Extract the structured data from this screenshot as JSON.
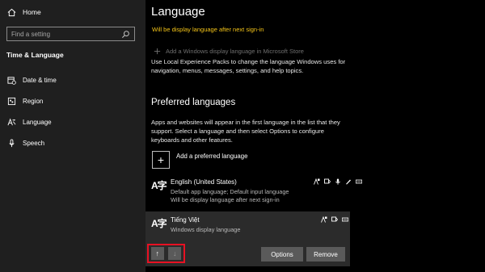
{
  "sidebar": {
    "home_label": "Home",
    "search_placeholder": "Find a setting",
    "section_title": "Time & Language",
    "items": [
      {
        "label": "Date & time",
        "icon": "calendar-clock-icon"
      },
      {
        "label": "Region",
        "icon": "globe-region-icon"
      },
      {
        "label": "Language",
        "icon": "language-icon"
      },
      {
        "label": "Speech",
        "icon": "microphone-icon"
      }
    ]
  },
  "main": {
    "title": "Language",
    "notice": "Will be display language after next sign-in",
    "store_link": "Add a Windows display language in Microsoft Store",
    "description": "Use Local Experience Packs to change the language Windows uses for navigation, menus, messages, settings, and help topics.",
    "preferred_heading": "Preferred languages",
    "preferred_description": "Apps and websites will appear in the first language in the list that they support. Select a language and then select Options to configure keyboards and other features.",
    "add_language": "Add a preferred language",
    "languages": [
      {
        "name": "English (United States)",
        "detail1": "Default app language; Default input language",
        "detail2": "Will be display language after next sign-in"
      },
      {
        "name": "Tiếng Việt",
        "detail1": "Windows display language"
      }
    ],
    "buttons": {
      "up": "↑",
      "down": "↓",
      "options": "Options",
      "remove": "Remove"
    }
  },
  "colors": {
    "notice": "#f5c518",
    "highlight_border": "#e81123",
    "sidebar_bg": "#1f1f1f",
    "selected_row": "#2b2b2b"
  }
}
